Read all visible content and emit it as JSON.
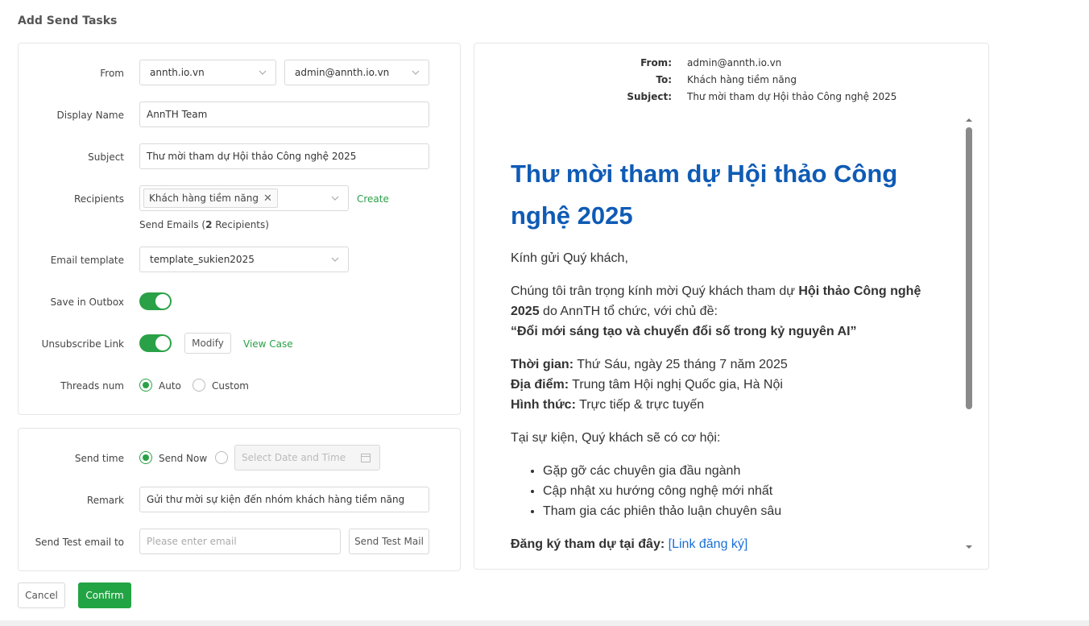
{
  "page_title": "Add Send Tasks",
  "form": {
    "from_label": "From",
    "from_domain": "annth.io.vn",
    "from_address": "admin@annth.io.vn",
    "display_name_label": "Display Name",
    "display_name": "AnnTH Team",
    "subject_label": "Subject",
    "subject": "Thư mời tham dự Hội thảo Công nghệ 2025",
    "recipients_label": "Recipients",
    "recipient_tag": "Khách hàng tiềm năng",
    "create_link": "Create",
    "send_emails_prefix": "Send Emails (",
    "send_emails_count": "2",
    "send_emails_suffix": " Recipients)",
    "email_template_label": "Email template",
    "email_template": "template_sukien2025",
    "save_outbox_label": "Save in Outbox",
    "unsubscribe_label": "Unsubscribe Link",
    "modify_button": "Modify",
    "view_case_link": "View Case",
    "threads_label": "Threads num",
    "threads_auto": "Auto",
    "threads_custom": "Custom"
  },
  "schedule": {
    "send_time_label": "Send time",
    "send_now": "Send Now",
    "date_placeholder": "Select Date and Time",
    "remark_label": "Remark",
    "remark": "Gửi thư mời sự kiện đến nhóm khách hàng tiềm năng",
    "test_email_label": "Send Test email to",
    "test_email_placeholder": "Please enter email",
    "send_test_button": "Send Test Mail"
  },
  "actions": {
    "cancel": "Cancel",
    "confirm": "Confirm"
  },
  "preview": {
    "from_label": "From:",
    "from": "admin@annth.io.vn",
    "to_label": "To:",
    "to": "Khách hàng tiềm năng",
    "subject_label": "Subject:",
    "subject": "Thư mời tham dự Hội thảo Công nghệ 2025",
    "heading": "Thư mời tham dự Hội thảo Công nghệ 2025",
    "greeting": "Kính gửi Quý khách,",
    "intro_1": "Chúng tôi trân trọng kính mời Quý khách tham dự ",
    "intro_bold": "Hội thảo Công nghệ 2025",
    "intro_2": " do AnnTH tổ chức, với chủ đề:",
    "theme": "“Đổi mới sáng tạo và chuyển đổi số trong kỷ nguyên AI”",
    "time_label": "Thời gian:",
    "time": " Thứ Sáu, ngày 25 tháng 7 năm 2025",
    "place_label": "Địa điểm:",
    "place": " Trung tâm Hội nghị Quốc gia, Hà Nội",
    "format_label": "Hình thức:",
    "format": " Trực tiếp & trực tuyến",
    "opportunity": "Tại sự kiện, Quý khách sẽ có cơ hội:",
    "bullets": [
      "Gặp gỡ các chuyên gia đầu ngành",
      "Cập nhật xu hướng công nghệ mới nhất",
      "Tham gia các phiên thảo luận chuyên sâu"
    ],
    "register_label": "Đăng ký tham dự tại đây:",
    "register_link": "[Link đăng ký]"
  },
  "colors": {
    "accent": "#23a444",
    "heading": "#0f5bb5",
    "link": "#1a6fd6"
  }
}
